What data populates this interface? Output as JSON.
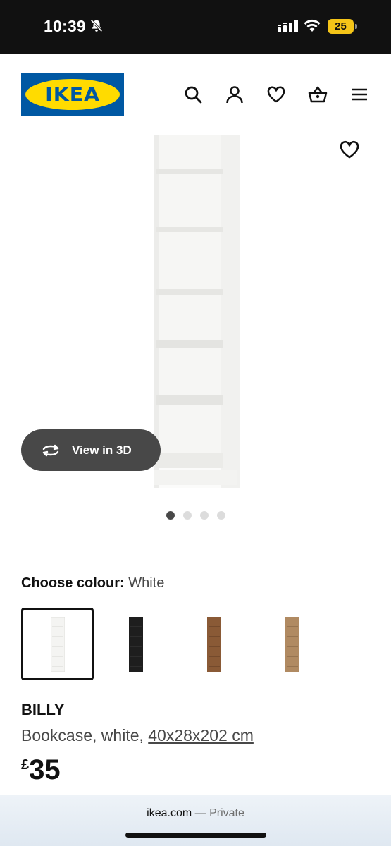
{
  "status_bar": {
    "time": "10:39",
    "battery": "25",
    "icons": [
      "bell-muted-icon",
      "signal-icon",
      "wifi-icon",
      "battery-icon"
    ]
  },
  "header": {
    "logo_text": "IKEA",
    "icons": [
      "search-icon",
      "account-icon",
      "heart-icon",
      "basket-icon",
      "menu-icon"
    ]
  },
  "gallery": {
    "view_3d_label": "View in 3D",
    "image_count": 4,
    "active_image": 1
  },
  "colour": {
    "label": "Choose colour:",
    "selected": "White",
    "options": [
      {
        "name": "White",
        "hex": "#f4f4f2"
      },
      {
        "name": "Black",
        "hex": "#1e1e1e"
      },
      {
        "name": "Brown",
        "hex": "#8a5a36"
      },
      {
        "name": "Oak",
        "hex": "#b08a62"
      }
    ]
  },
  "product": {
    "name": "BILLY",
    "description": "Bookcase, white, ",
    "size": "40x28x202 cm",
    "currency": "£",
    "price": "35"
  },
  "browser": {
    "domain": "ikea.com",
    "separator": " — ",
    "mode": "Private"
  },
  "colors": {
    "ikea_blue": "#0058a3",
    "ikea_yellow": "#ffdb00",
    "button_dark": "#484848"
  }
}
